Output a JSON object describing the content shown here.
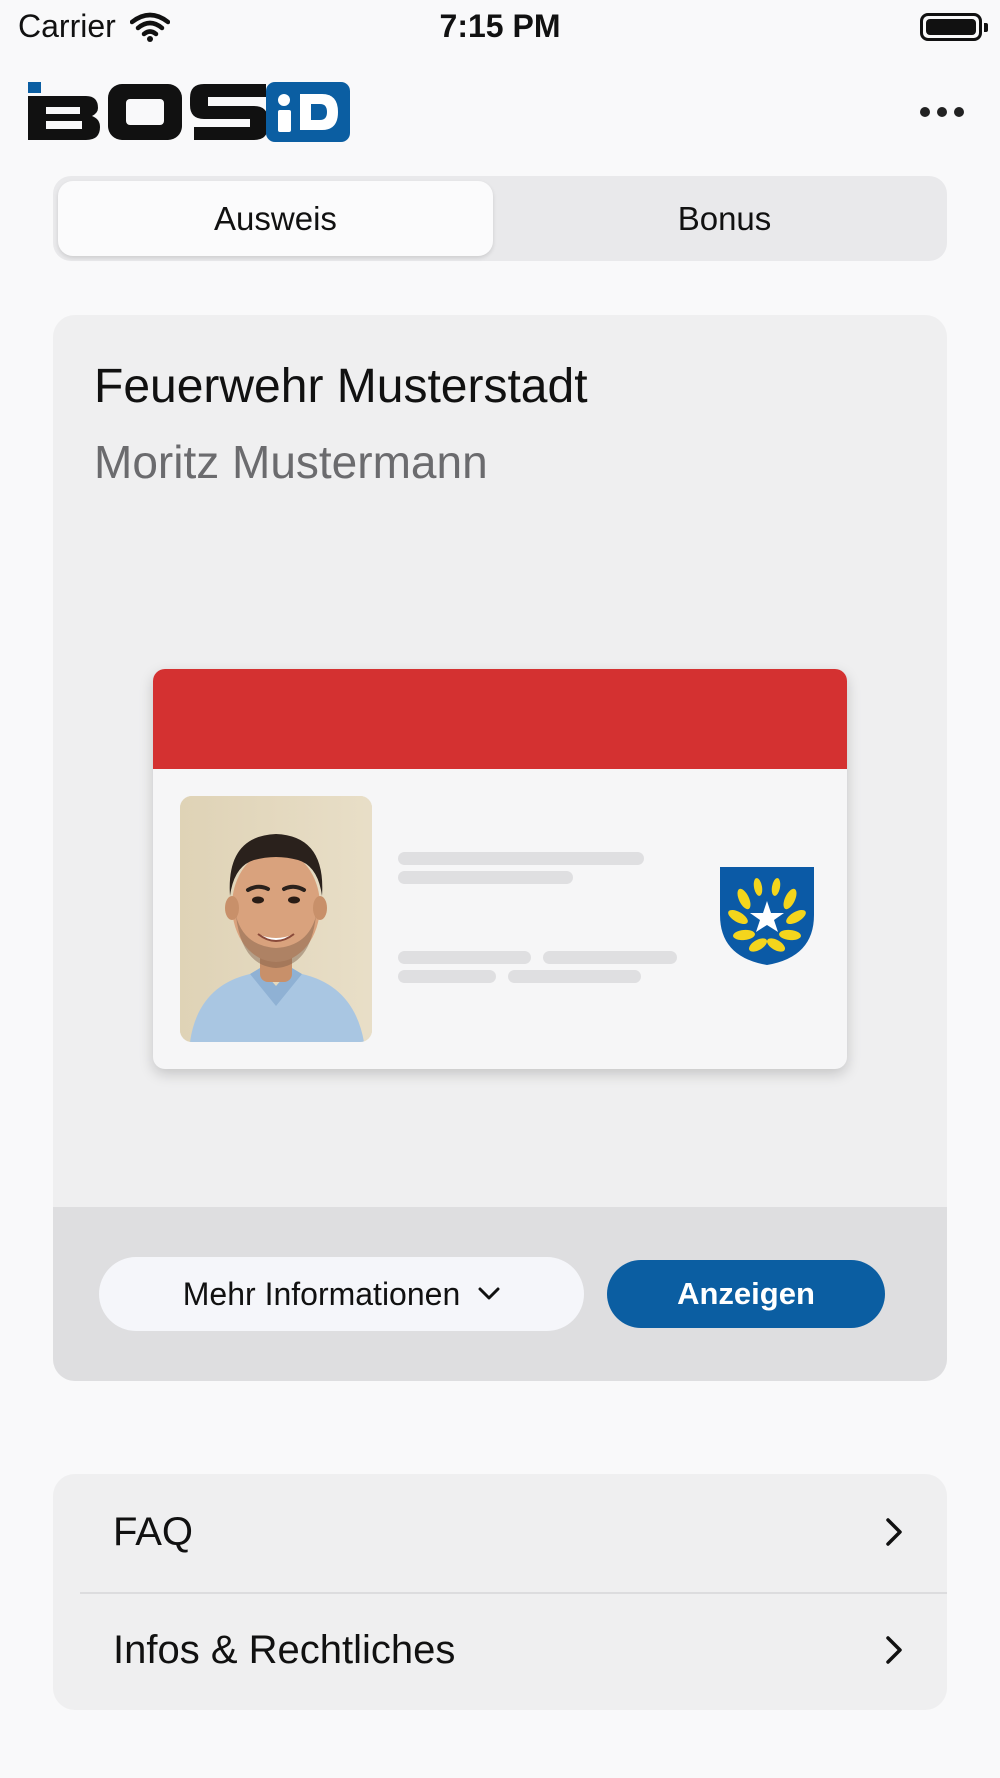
{
  "status_bar": {
    "carrier": "Carrier",
    "time": "7:15 PM"
  },
  "header": {
    "logo_text": "BOS iD",
    "more_icon": "ellipsis-icon"
  },
  "tabs": [
    {
      "label": "Ausweis",
      "selected": true
    },
    {
      "label": "Bonus",
      "selected": false
    }
  ],
  "card": {
    "title": "Feuerwehr Musterstadt",
    "name": "Moritz Mustermann",
    "band_color": "#d43131",
    "more_info_label": "Mehr Informationen",
    "show_label": "Anzeigen",
    "accent_color": "#0b5ea2"
  },
  "list": [
    {
      "label": "FAQ"
    },
    {
      "label": "Infos & Rechtliches"
    }
  ]
}
